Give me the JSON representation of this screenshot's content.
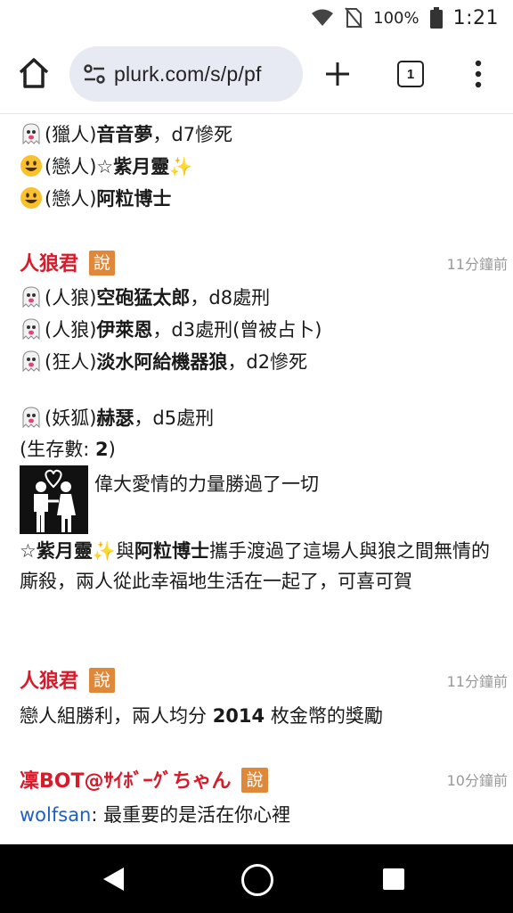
{
  "status": {
    "battery_text": "100%",
    "time": "1:21"
  },
  "browser": {
    "url": "plurk.com/s/p/pf",
    "tab_count": "1"
  },
  "prev_tail": [
    {
      "icon": "ghost-icon",
      "role": "(獵人)",
      "name": "音音夢",
      "detail": "，d7慘死"
    },
    {
      "icon": "smiley-icon",
      "role": "(戀人)",
      "name": "☆紫月靈",
      "sparkle": "✨",
      "detail": ""
    },
    {
      "icon": "smiley-icon",
      "role": "(戀人)",
      "name": "阿粒博士",
      "detail": ""
    }
  ],
  "post1": {
    "author": "人狼君",
    "say": "說",
    "time": "11分鐘前",
    "lines": [
      {
        "icon": "ghost-icon",
        "role": "(人狼)",
        "name": "空砲猛太郎",
        "detail": "，d8處刑"
      },
      {
        "icon": "ghost-icon",
        "role": "(人狼)",
        "name": "伊萊恩",
        "detail": "，d3處刑(曾被占卜)"
      },
      {
        "icon": "ghost-icon",
        "role": "(狂人)",
        "name": "淡水阿給機器狼",
        "detail": "，d2慘死"
      },
      {
        "icon": "ghost-icon",
        "role": "(妖狐)",
        "name": "赫瑟",
        "detail": "，d5處刑"
      }
    ],
    "survivors_prefix": "(生存數: ",
    "survivors_count": "2",
    "survivors_suffix": ")",
    "love_caption": "偉大愛情的力量勝過了一切",
    "ending_name1": "☆紫月靈",
    "ending_sparkle": "✨",
    "ending_mid": "與",
    "ending_name2": "阿粒博士",
    "ending_rest": "攜手渡過了這場人與狼之間無情的廝殺，兩人從此幸福地生活在一起了，可喜可賀"
  },
  "post2": {
    "author": "人狼君",
    "say": "說",
    "time": "11分鐘前",
    "text_prefix": "戀人組勝利，兩人均分 ",
    "coins": "2014",
    "text_suffix": " 枚金幣的獎勵"
  },
  "post3": {
    "author": "凜BOT@ｻｲﾎﾞｰｸﾞちゃん",
    "say": "說",
    "time": "10分鐘前",
    "mention": "wolfsan",
    "text": ": 最重要的是活在你心裡"
  },
  "colors": {
    "author": "#d81b2a",
    "say_badge": "#e0883a",
    "link": "#1f5fbf",
    "url_bar": "#e8eaf3"
  }
}
